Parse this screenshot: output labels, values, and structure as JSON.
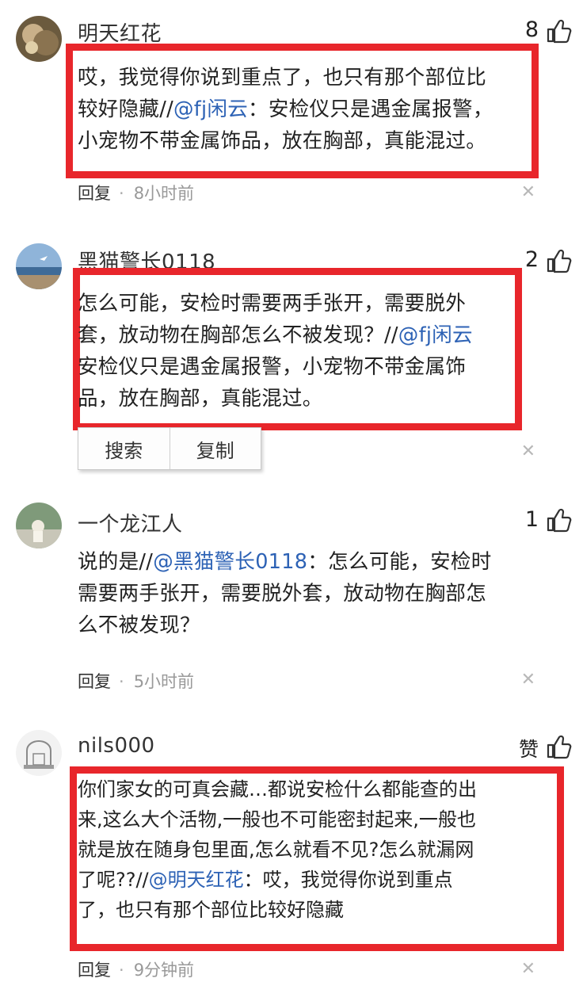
{
  "comments": [
    {
      "username": "明天红花",
      "likes": "8",
      "lines": [
        [
          {
            "t": "哎，我觉得你说到重点了，也只有那个部位比"
          }
        ],
        [
          {
            "t": "较好隐藏//"
          },
          {
            "t": "@fj闲云",
            "m": true
          },
          {
            "t": "：安检仪只是遇金属报警，"
          }
        ],
        [
          {
            "t": "小宠物不带金属饰品，放在胸部，真能混过。"
          }
        ]
      ],
      "reply_label": "回复",
      "time": "8小时前"
    },
    {
      "username": "黑猫警长0118",
      "likes": "2",
      "lines": [
        [
          {
            "t": "怎么可能，安检时需要两手张开，需要脱外"
          }
        ],
        [
          {
            "t": "套，放动物在胸部怎么不被发现？//"
          },
          {
            "t": "@fj闲云",
            "m": true
          }
        ],
        [
          {
            "t": "安检仪只是遇金属报警，小宠物不带金属饰"
          }
        ],
        [
          {
            "t": "品，放在胸部，真能混过。"
          }
        ]
      ],
      "context_menu": [
        "搜索",
        "复制"
      ]
    },
    {
      "username": "一个龙江人",
      "likes": "1",
      "lines": [
        [
          {
            "t": "说的是//"
          },
          {
            "t": "@黑猫警长0118",
            "m": true
          },
          {
            "t": "：怎么可能，安检时"
          }
        ],
        [
          {
            "t": "需要两手张开，需要脱外套，放动物在胸部怎"
          }
        ],
        [
          {
            "t": "么不被发现？"
          }
        ]
      ],
      "reply_label": "回复",
      "time": "5小时前"
    },
    {
      "username": "nils000",
      "likes": "赞",
      "lines": [
        [
          {
            "t": "你们家女的可真会藏…都说安检什么都能查的出"
          }
        ],
        [
          {
            "t": "来,这么大个活物,一般也不可能密封起来,一般也"
          }
        ],
        [
          {
            "t": "就是放在随身包里面,怎么就看不见?怎么就漏网"
          }
        ],
        [
          {
            "t": "了呢??//"
          },
          {
            "t": "@明天红花",
            "m": true
          },
          {
            "t": "：哎，我觉得你说到重点"
          }
        ],
        [
          {
            "t": "了，也只有那个部位比较好隐藏"
          }
        ]
      ],
      "reply_label": "回复",
      "time": "9分钟前"
    }
  ],
  "colors": {
    "highlight_border": "#e8262b",
    "mention": "#2d62b5",
    "text": "#222222",
    "muted": "#999999"
  },
  "icons": {
    "like": "thumbs-up-icon",
    "close": "close-icon"
  }
}
